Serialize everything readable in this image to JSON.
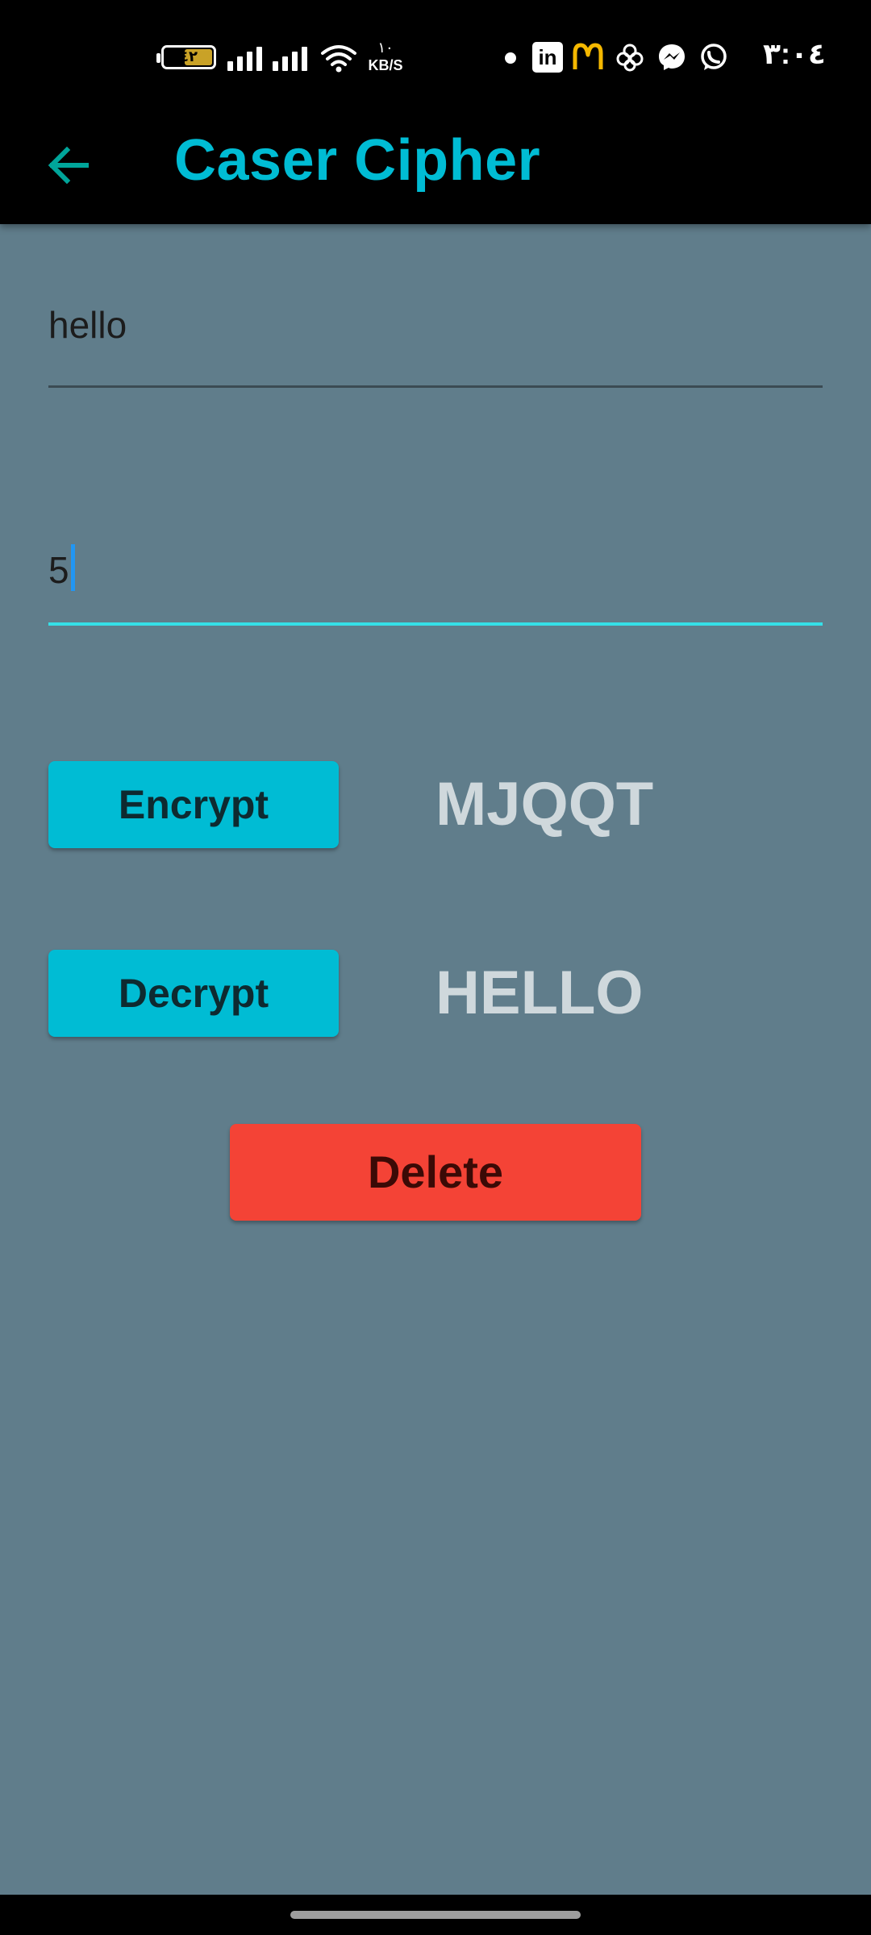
{
  "status_bar": {
    "battery_level": "٤٢",
    "network_speed_value": "١٠",
    "network_speed_unit": "KB/S",
    "time": "٣:٠٤",
    "notification_icons": [
      "linkedin-icon",
      "mcdonalds-icon",
      "clover-icon",
      "messenger-icon",
      "whatsapp-icon"
    ]
  },
  "app_bar": {
    "title": "Caser Cipher",
    "back_icon": "arrow-left-icon"
  },
  "form": {
    "text_input_value": "hello",
    "shift_input_value": "5"
  },
  "actions": {
    "encrypt_label": "Encrypt",
    "decrypt_label": "Decrypt",
    "delete_label": "Delete"
  },
  "results": {
    "encrypted": "MJQQT",
    "decrypted": "HELLO"
  },
  "colors": {
    "background": "#607d8b",
    "accent": "#00bcd4",
    "delete": "#f44336",
    "focus_line": "#35e0e8"
  }
}
